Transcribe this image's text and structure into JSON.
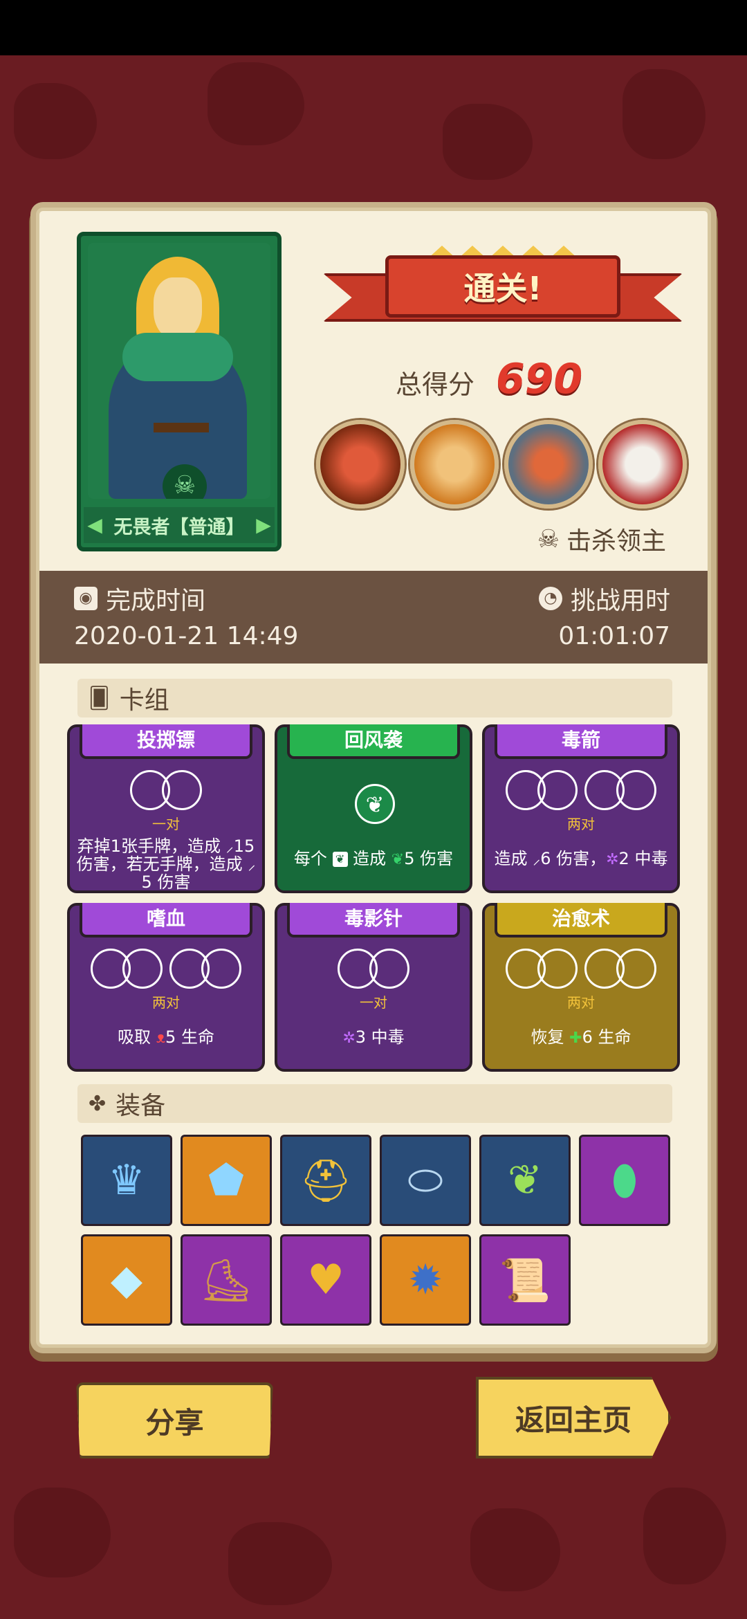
{
  "hero": {
    "name": "无畏者【普通】"
  },
  "banner": {
    "title": "通关!"
  },
  "score": {
    "label": "总得分",
    "value": "690"
  },
  "bosses": {
    "kill_label": "击杀领主",
    "avatars": [
      "boss-1",
      "boss-2",
      "boss-3",
      "boss-4"
    ]
  },
  "time": {
    "finish_label": "完成时间",
    "finish_value": "2020-01-21 14:49",
    "duration_label": "挑战用时",
    "duration_value": "01:01:07"
  },
  "deck": {
    "label": "卡组",
    "cards": [
      {
        "title": "投掷镖",
        "color": "purple",
        "slots": "一对",
        "desc": "弃掉1张手牌，造成 15 伤害，若无手牌，造成 5 伤害"
      },
      {
        "title": "回风袭",
        "color": "green",
        "slots": "",
        "desc": "每个 造成 5 伤害"
      },
      {
        "title": "毒箭",
        "color": "purple",
        "slots": "两对",
        "desc": "造成 6 伤害， 2 中毒"
      },
      {
        "title": "嗜血",
        "color": "purple",
        "slots": "两对",
        "desc": "吸取 5 生命"
      },
      {
        "title": "毒影针",
        "color": "purple",
        "slots": "一对",
        "desc": "3 中毒"
      },
      {
        "title": "治愈术",
        "color": "gold",
        "slots": "两对",
        "desc": "恢复 6 生命"
      }
    ]
  },
  "equipment": {
    "label": "装备",
    "items": [
      {
        "icon": "crown-icon",
        "bg": "blue"
      },
      {
        "icon": "shield-icon",
        "bg": "orange"
      },
      {
        "icon": "helmet-icon",
        "bg": "blue"
      },
      {
        "icon": "bandage-icon",
        "bg": "blue"
      },
      {
        "icon": "leaf-icon",
        "bg": "blue"
      },
      {
        "icon": "green-gem-icon",
        "bg": "purple"
      },
      {
        "icon": "diamond-icon",
        "bg": "orange"
      },
      {
        "icon": "boot-icon",
        "bg": "purple"
      },
      {
        "icon": "heart-amulet-icon",
        "bg": "purple"
      },
      {
        "icon": "spiked-ball-icon",
        "bg": "orange"
      },
      {
        "icon": "scroll-icon",
        "bg": "purple"
      }
    ]
  },
  "buttons": {
    "share": "分享",
    "home": "返回主页"
  }
}
